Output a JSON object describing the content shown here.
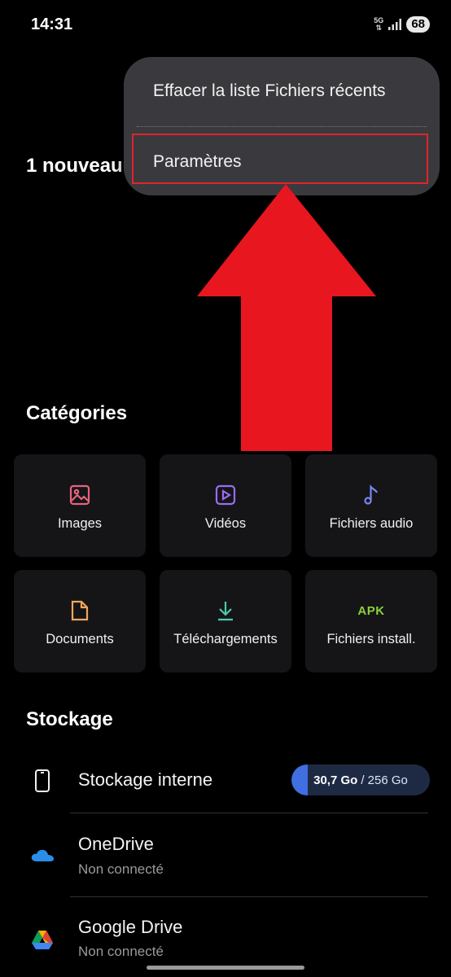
{
  "status_bar": {
    "time": "14:31",
    "network_type": "5G",
    "battery": "68"
  },
  "recent": {
    "title": "1 nouveau"
  },
  "menu": {
    "items": [
      {
        "label": "Effacer la liste Fichiers récents"
      },
      {
        "label": "Paramètres",
        "highlighted": true
      }
    ],
    "highlight_color": "#e0242c"
  },
  "annotation": {
    "arrow_color": "#e8161f",
    "arrow_direction": "up"
  },
  "categories": {
    "title": "Catégories",
    "items": [
      {
        "label": "Images",
        "icon": "image-icon",
        "color": "#e5647a"
      },
      {
        "label": "Vidéos",
        "icon": "video-icon",
        "color": "#9b6cf0"
      },
      {
        "label": "Fichiers audio",
        "icon": "music-note-icon",
        "color": "#7a86f0"
      },
      {
        "label": "Documents",
        "icon": "document-icon",
        "color": "#f0a85a"
      },
      {
        "label": "Téléchargements",
        "icon": "download-icon",
        "color": "#4ec9b0"
      },
      {
        "label": "Fichiers install.",
        "icon": "apk-icon",
        "icon_text": "APK",
        "color": "#8bd13a"
      }
    ]
  },
  "storage": {
    "title": "Stockage",
    "items": [
      {
        "name": "Stockage interne",
        "icon": "phone-icon",
        "used": "30,7 Go",
        "total": "/ 256 Go",
        "used_fraction": 0.12
      },
      {
        "name": "OneDrive",
        "icon": "onedrive-icon",
        "status": "Non connecté"
      },
      {
        "name": "Google Drive",
        "icon": "google-drive-icon",
        "status": "Non connecté"
      }
    ]
  }
}
